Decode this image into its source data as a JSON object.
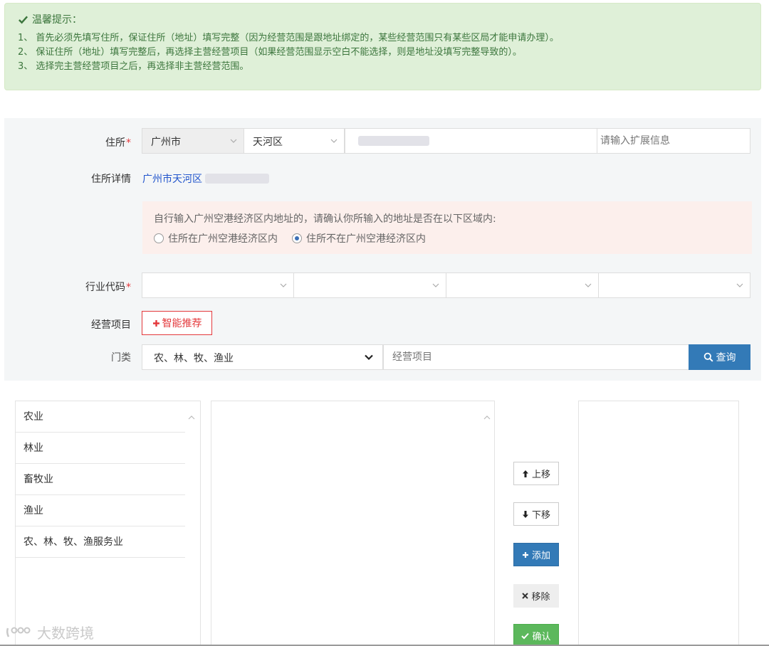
{
  "tips": {
    "title": "温馨提示：",
    "lines": [
      "1、 首先必须先填写住所，保证住所（地址）填写完整（因为经营范围是跟地址绑定的，某些经营范围只有某些区局才能申请办理）。",
      "2、 保证住所（地址）填写完整后，再选择主营经营项目（如果经营范围显示空白不能选择，则是地址没填写完整导致的）。",
      "3、 选择完主营经营项目之后，再选择非主营经营范围。"
    ]
  },
  "form": {
    "address_label": "住所",
    "required_mark": "*",
    "city": "广州市",
    "district": "天河区",
    "ext_placeholder": "请输入扩展信息",
    "detail_label": "住所详情",
    "detail_value": "广州市天河区",
    "notice_text": "自行输入广州空港经济区内地址的，请确认你所输入的地址是否在以下区域内:",
    "radio_in": "住所在广州空港经济区内",
    "radio_out": "住所不在广州空港经济区内",
    "industry_label": "行业代码",
    "business_label": "经营项目",
    "smart_button": "智能推荐",
    "category_label": "门类",
    "category_value": "农、林、牧、渔业",
    "item_placeholder": "经营项目",
    "query_button": "查询"
  },
  "lists": {
    "left_items": [
      "农业",
      "林业",
      "畜牧业",
      "渔业",
      "农、林、牧、渔服务业"
    ]
  },
  "actions": {
    "up": "上移",
    "down": "下移",
    "add": "添加",
    "remove": "移除",
    "confirm": "确认"
  },
  "watermark": "大数跨境",
  "colors": {
    "tips_bg": "#dff0d8",
    "tips_text": "#3c763d",
    "required": "#e4393c",
    "primary": "#337ab7",
    "success": "#5cb85c",
    "link": "#2255cc"
  }
}
